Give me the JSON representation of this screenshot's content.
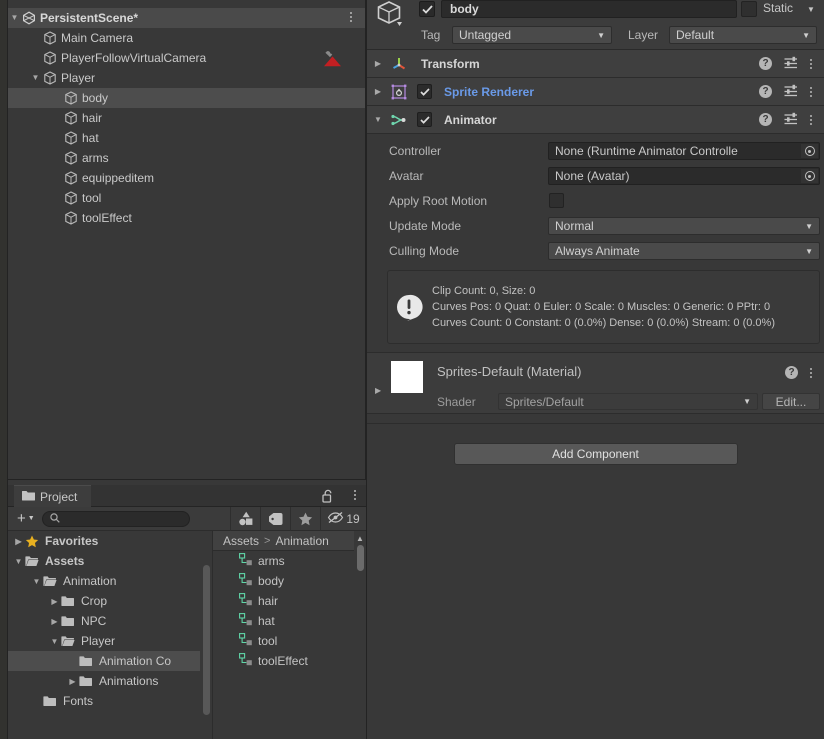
{
  "hierarchy": {
    "scene": {
      "label": "PersistentScene*",
      "icon": "scene-icon",
      "expanded": true
    },
    "items": [
      {
        "label": "Main Camera",
        "depth": 1,
        "expanded": null,
        "icon": "gameobject-icon",
        "gizmo": "camera-audio-gizmo"
      },
      {
        "label": "PlayerFollowVirtualCamera",
        "depth": 1,
        "expanded": null,
        "icon": "gameobject-icon"
      },
      {
        "label": "Player",
        "depth": 1,
        "expanded": true,
        "icon": "gameobject-icon"
      },
      {
        "label": "body",
        "depth": 2,
        "expanded": null,
        "icon": "gameobject-icon",
        "selected": true
      },
      {
        "label": "hair",
        "depth": 2,
        "expanded": null,
        "icon": "gameobject-icon"
      },
      {
        "label": "hat",
        "depth": 2,
        "expanded": null,
        "icon": "gameobject-icon"
      },
      {
        "label": "arms",
        "depth": 2,
        "expanded": null,
        "icon": "gameobject-icon"
      },
      {
        "label": "equippeditem",
        "depth": 2,
        "expanded": null,
        "icon": "gameobject-icon"
      },
      {
        "label": "tool",
        "depth": 2,
        "expanded": null,
        "icon": "gameobject-icon"
      },
      {
        "label": "toolEffect",
        "depth": 2,
        "expanded": null,
        "icon": "gameobject-icon"
      }
    ]
  },
  "inspector": {
    "object_name": "body",
    "active": true,
    "static_label": "Static",
    "static_checked": false,
    "tag_label": "Tag",
    "tag_value": "Untagged",
    "layer_label": "Layer",
    "layer_value": "Default",
    "components": [
      {
        "name": "Transform",
        "icon": "transform-icon",
        "expanded": false,
        "has_checkbox": false,
        "link": false
      },
      {
        "name": "Sprite Renderer",
        "icon": "sprite-renderer-icon",
        "expanded": false,
        "has_checkbox": true,
        "checked": true,
        "link": true
      },
      {
        "name": "Animator",
        "icon": "animator-icon",
        "expanded": true,
        "has_checkbox": true,
        "checked": true,
        "link": false
      }
    ],
    "animator": {
      "rows": [
        {
          "label": "Controller",
          "type": "object",
          "value": "None (Runtime Animator Controlle"
        },
        {
          "label": "Avatar",
          "type": "object",
          "value": "None (Avatar)"
        },
        {
          "label": "Apply Root Motion",
          "type": "checkbox",
          "checked": false
        },
        {
          "label": "Update Mode",
          "type": "enum",
          "value": "Normal"
        },
        {
          "label": "Culling Mode",
          "type": "enum",
          "value": "Always Animate"
        }
      ],
      "info": [
        "Clip Count: 0, Size: 0",
        "Curves Pos: 0 Quat: 0 Euler: 0 Scale: 0 Muscles: 0 Generic: 0 PPtr: 0",
        "Curves Count: 0 Constant: 0 (0.0%) Dense: 0 (0.0%) Stream: 0 (0.0%)"
      ]
    },
    "material": {
      "title": "Sprites-Default (Material)",
      "shader_label": "Shader",
      "shader_value": "Sprites/Default",
      "edit_label": "Edit...",
      "swatch_color": "#ffffff"
    },
    "add_component_label": "Add Component"
  },
  "project": {
    "tab_label": "Project",
    "tab_icon": "folder-icon",
    "lock_icon": "lock-open-icon",
    "create_label": "+",
    "search_value": "",
    "search_placeholder": "",
    "toolbar_icons": [
      "shapes-filter-icon",
      "label-tag-icon",
      "favorite-star-icon"
    ],
    "hidden_count": "19",
    "breadcrumb": [
      "Assets",
      "Animation"
    ],
    "tree": [
      {
        "label": "Favorites",
        "depth": 0,
        "expanded": false,
        "icon": "star-icon",
        "bold": true
      },
      {
        "label": "Assets",
        "depth": 0,
        "expanded": true,
        "icon": "folder-open-icon",
        "bold": true
      },
      {
        "label": "Animation",
        "depth": 1,
        "expanded": true,
        "icon": "folder-open-icon"
      },
      {
        "label": "Crop",
        "depth": 2,
        "expanded": false,
        "icon": "folder-icon"
      },
      {
        "label": "NPC",
        "depth": 2,
        "expanded": false,
        "icon": "folder-icon"
      },
      {
        "label": "Player",
        "depth": 2,
        "expanded": true,
        "icon": "folder-open-icon"
      },
      {
        "label": "Animation Co",
        "depth": 3,
        "expanded": null,
        "icon": "folder-icon",
        "selected": true
      },
      {
        "label": "Animations",
        "depth": 3,
        "expanded": false,
        "icon": "folder-icon"
      },
      {
        "label": "Fonts",
        "depth": 1,
        "expanded": null,
        "icon": "folder-icon"
      }
    ],
    "assets": [
      {
        "label": "arms",
        "icon": "animator-controller-icon"
      },
      {
        "label": "body",
        "icon": "animator-controller-icon"
      },
      {
        "label": "hair",
        "icon": "animator-controller-icon"
      },
      {
        "label": "hat",
        "icon": "animator-controller-icon"
      },
      {
        "label": "tool",
        "icon": "animator-controller-icon"
      },
      {
        "label": "toolEffect",
        "icon": "animator-controller-icon"
      }
    ]
  },
  "colors": {
    "panel_bg": "#383838",
    "header_bg": "#3c3c3c",
    "selected_row": "#4d4d4d",
    "link_blue": "#6a9ae8",
    "field_bg": "#2b2b2b",
    "dropdown_bg": "#4a4a4a",
    "animator_green": "#6fd6ae",
    "sprite_purple": "#b58ae0",
    "star_gold": "#e8b020",
    "gizmo_red": "#c21f22"
  }
}
